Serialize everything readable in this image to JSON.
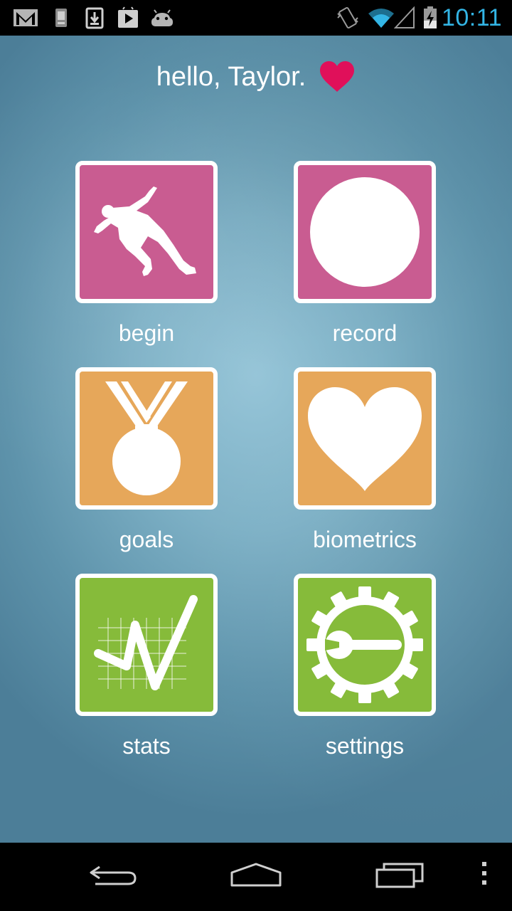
{
  "status_bar": {
    "time": "10:11",
    "time_color": "#33b5e5",
    "left_icons": [
      "gmail-icon",
      "phone-storage-icon",
      "download-icon",
      "play-store-icon",
      "android-icon"
    ],
    "right_icons": [
      "vibrate-icon",
      "wifi-icon",
      "cell-signal-icon",
      "battery-charging-icon"
    ]
  },
  "greeting": {
    "text": "hello, Taylor.",
    "heart_color": "#e0105a"
  },
  "tiles": [
    {
      "label": "begin",
      "icon": "runner-icon",
      "color": "#c95c91"
    },
    {
      "label": "record",
      "icon": "record-circle-icon",
      "color": "#c95c91"
    },
    {
      "label": "goals",
      "icon": "medal-icon",
      "color": "#e6a75a"
    },
    {
      "label": "biometrics",
      "icon": "heart-icon",
      "color": "#e6a75a"
    },
    {
      "label": "stats",
      "icon": "chart-icon",
      "color": "#86bb3a"
    },
    {
      "label": "settings",
      "icon": "gear-wrench-icon",
      "color": "#86bb3a"
    }
  ],
  "nav_bar": {
    "buttons": [
      "back-icon",
      "home-icon",
      "recent-apps-icon",
      "overflow-menu-icon"
    ]
  }
}
